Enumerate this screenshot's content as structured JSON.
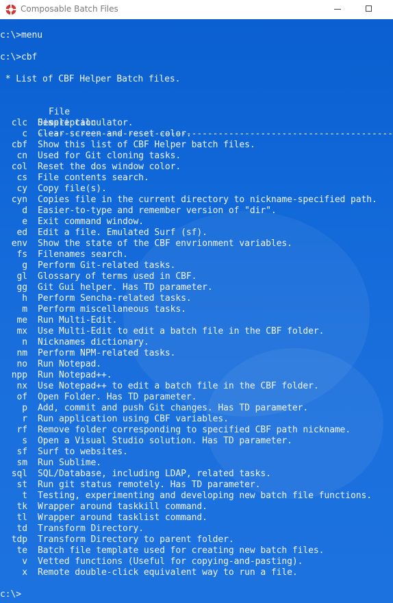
{
  "window": {
    "title": "Composable Batch Files"
  },
  "console": {
    "cmd1": "c:\\>menu",
    "cmd2": "c:\\>cbf",
    "intro": " * List of CBF Helper Batch files.",
    "header_file": "File",
    "header_desc": "Description",
    "sep_file": "----",
    "sep_desc": "------------------------------------------------------------------------",
    "prompt": "c:\\>",
    "rows": [
      {
        "code": "clc",
        "desc": "Simple calculator."
      },
      {
        "code": "c",
        "desc": "Clear screen and reset color."
      },
      {
        "code": "cbf",
        "desc": "Show this list of CBF Helper batch files."
      },
      {
        "code": "cn",
        "desc": "Used for Git cloning tasks."
      },
      {
        "code": "col",
        "desc": "Reset the dos window color."
      },
      {
        "code": "cs",
        "desc": "File contents search."
      },
      {
        "code": "cy",
        "desc": "Copy file(s)."
      },
      {
        "code": "cyn",
        "desc": "Copies file in the current directory to nickname-specified path."
      },
      {
        "code": "d",
        "desc": "Easier-to-type and remember version of \"dir\"."
      },
      {
        "code": "e",
        "desc": "Exit command window."
      },
      {
        "code": "ed",
        "desc": "Edit a file. Emulated Surf (sf)."
      },
      {
        "code": "env",
        "desc": "Show the state of the CBF envrionment variables."
      },
      {
        "code": "fs",
        "desc": "Filenames search."
      },
      {
        "code": "g",
        "desc": "Perform Git-related tasks."
      },
      {
        "code": "gl",
        "desc": "Glossary of terms used in CBF."
      },
      {
        "code": "gg",
        "desc": "Git Gui helper. Has TD parameter."
      },
      {
        "code": "h",
        "desc": "Perform Sencha-related tasks."
      },
      {
        "code": "m",
        "desc": "Perform miscellaneous tasks."
      },
      {
        "code": "me",
        "desc": "Run Multi-Edit."
      },
      {
        "code": "mx",
        "desc": "Use Multi-Edit to edit a batch file in the CBF folder."
      },
      {
        "code": "n",
        "desc": "Nicknames dictionary."
      },
      {
        "code": "nm",
        "desc": "Perform NPM-related tasks."
      },
      {
        "code": "no",
        "desc": "Run Notepad."
      },
      {
        "code": "npp",
        "desc": "Run Notepad++."
      },
      {
        "code": "nx",
        "desc": "Use Notepad++ to edit a batch file in the CBF folder."
      },
      {
        "code": "of",
        "desc": "Open Folder. Has TD parameter."
      },
      {
        "code": "p",
        "desc": "Add, commit and push Git changes. Has TD parameter."
      },
      {
        "code": "r",
        "desc": "Run application using CBF variables."
      },
      {
        "code": "rf",
        "desc": "Remove folder corresponding to specified CBF path nickname."
      },
      {
        "code": "s",
        "desc": "Open a Visual Studio solution. Has TD parameter."
      },
      {
        "code": "sf",
        "desc": "Surf to websites."
      },
      {
        "code": "sm",
        "desc": "Run Sublime."
      },
      {
        "code": "sql",
        "desc": "SQL/Database, including LDAP, related tasks."
      },
      {
        "code": "st",
        "desc": "Run git status remotely. Has TD parameter."
      },
      {
        "code": "t",
        "desc": "Testing, experimenting and developing new batch file functions."
      },
      {
        "code": "tk",
        "desc": "Wrapper around taskkill command."
      },
      {
        "code": "tl",
        "desc": "Wrapper around tasklist command."
      },
      {
        "code": "td",
        "desc": "Transform Directory."
      },
      {
        "code": "tdp",
        "desc": "Transform Directory to parent folder."
      },
      {
        "code": "te",
        "desc": "Batch file template used for creating new batch files."
      },
      {
        "code": "v",
        "desc": "Vetted functions (Useful for copying-and-pasting)."
      },
      {
        "code": "x",
        "desc": "Remote double-click equivalent way to run a file."
      }
    ]
  },
  "icons": {
    "app": "cbf-app-icon",
    "minimize": "minimize-icon",
    "maximize": "maximize-icon"
  },
  "colors": {
    "console_bg": "#1168d8",
    "console_text": "#f2f6ff",
    "titlebar_bg": "#ffffff",
    "app_icon": "#d8332e"
  }
}
